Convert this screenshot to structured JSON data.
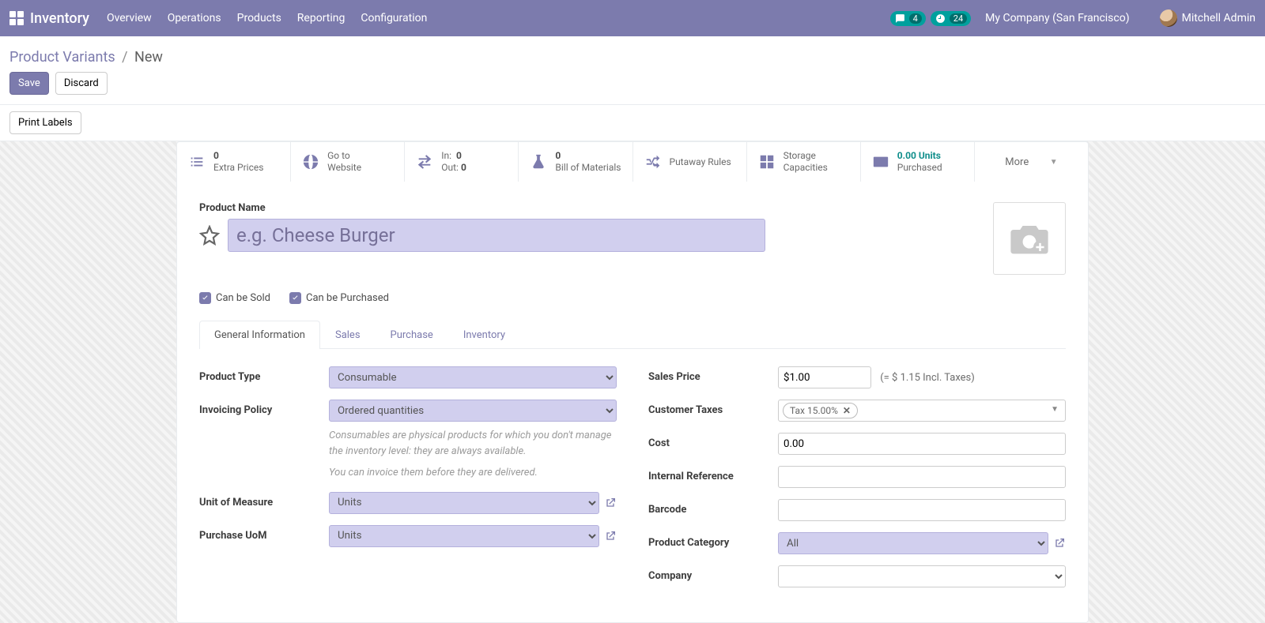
{
  "topnav": {
    "brand": "Inventory",
    "items": [
      "Overview",
      "Operations",
      "Products",
      "Reporting",
      "Configuration"
    ],
    "messages_count": "4",
    "activities_count": "24",
    "company": "My Company (San Francisco)",
    "user": "Mitchell Admin"
  },
  "breadcrumb": {
    "parent": "Product Variants",
    "current": "New"
  },
  "buttons": {
    "save": "Save",
    "discard": "Discard",
    "print_labels": "Print Labels"
  },
  "stats": {
    "extra_prices": {
      "count": "0",
      "label": "Extra Prices"
    },
    "website": {
      "line1": "Go to",
      "line2": "Website"
    },
    "transfers": {
      "in_label": "In:",
      "in_value": "0",
      "out_label": "Out:",
      "out_value": "0"
    },
    "bom": {
      "count": "0",
      "label": "Bill of Materials"
    },
    "putaway": {
      "label": "Putaway Rules"
    },
    "storage": {
      "line1": "Storage",
      "line2": "Capacities"
    },
    "purchased": {
      "value": "0.00 Units",
      "label": "Purchased"
    },
    "more": "More"
  },
  "product": {
    "name_label": "Product Name",
    "name_placeholder": "e.g. Cheese Burger",
    "can_be_sold": "Can be Sold",
    "can_be_purchased": "Can be Purchased"
  },
  "tabs": [
    "General Information",
    "Sales",
    "Purchase",
    "Inventory"
  ],
  "form": {
    "product_type": {
      "label": "Product Type",
      "value": "Consumable"
    },
    "invoicing_policy": {
      "label": "Invoicing Policy",
      "value": "Ordered quantities"
    },
    "help1": "Consumables are physical products for which you don't manage the inventory level: they are always available.",
    "help2": "You can invoice them before they are delivered.",
    "uom": {
      "label": "Unit of Measure",
      "value": "Units"
    },
    "purchase_uom": {
      "label": "Purchase UoM",
      "value": "Units"
    },
    "sales_price": {
      "label": "Sales Price",
      "value": "$1.00",
      "extra": "(= $ 1.15 Incl. Taxes)"
    },
    "customer_taxes": {
      "label": "Customer Taxes",
      "tag": "Tax 15.00%"
    },
    "cost": {
      "label": "Cost",
      "value": "0.00"
    },
    "internal_ref": {
      "label": "Internal Reference",
      "value": ""
    },
    "barcode": {
      "label": "Barcode",
      "value": ""
    },
    "category": {
      "label": "Product Category",
      "value": "All"
    },
    "company": {
      "label": "Company",
      "value": ""
    }
  }
}
